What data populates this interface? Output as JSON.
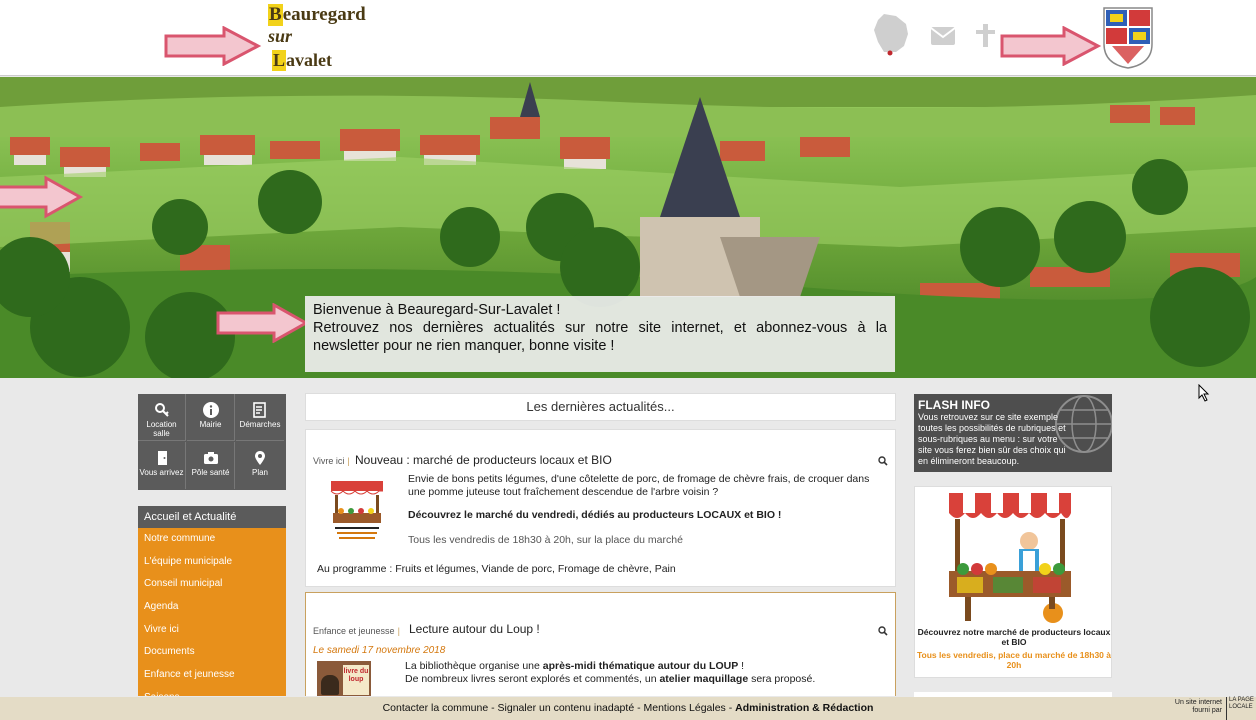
{
  "header": {
    "logo": {
      "line1_cap": "B",
      "line1_rest": "eauregard",
      "line2": "sur",
      "line3_cap": "L",
      "line3_rest": "avalet"
    },
    "icons": [
      "france-map-icon",
      "mail-icon",
      "cross-icon",
      "coat-of-arms-icon"
    ]
  },
  "hero": {
    "welcome_line1": "Bienvenue à Beauregard-Sur-Lavalet !",
    "welcome_line2": "Retrouvez nos dernières actualités sur notre site internet, et abonnez-vous à la newsletter pour ne rien manquer, bonne visite !"
  },
  "quick_links": [
    {
      "label": "Location salle",
      "icon": "key-icon"
    },
    {
      "label": "Mairie",
      "icon": "info-icon"
    },
    {
      "label": "Démarches",
      "icon": "form-icon"
    },
    {
      "label": "Vous arrivez",
      "icon": "door-icon"
    },
    {
      "label": "Pôle santé",
      "icon": "camera-icon"
    },
    {
      "label": "Plan",
      "icon": "map-pin-icon"
    }
  ],
  "menu": {
    "active": "Accueil et Actualité",
    "items": [
      "Notre commune",
      "L'équipe municipale",
      "Conseil municipal",
      "Agenda",
      "Vivre ici",
      "Documents",
      "Enfance et jeunesse",
      "Saisons"
    ]
  },
  "center": {
    "title": "Les dernières actualités...",
    "article1": {
      "category": "Vivre ici",
      "title": "Nouveau : marché de producteurs locaux et BIO",
      "text1": "Envie de bons petits légumes, d'une côtelette de porc, de fromage de chèvre frais, de croquer dans une pomme juteuse tout fraîchement descendue de l'arbre voisin ?",
      "text2": "Découvrez le marché du vendredi, dédiés au producteurs LOCAUX et BIO !",
      "text3": "Tous les vendredis de 18h30 à 20h, sur la place du marché",
      "program": "Au programme : Fruits et légumes, Viande de porc, Fromage de chèvre, Pain"
    },
    "article2": {
      "category": "Enfance et jeunesse",
      "title": "Lecture autour du Loup !",
      "date": "Le samedi 17 novembre 2018",
      "text1_a": "La bibliothèque organise une ",
      "text1_b": "après-midi thématique autour du LOUP",
      "text1_c": " !",
      "text2_a": "De nombreux livres seront explorés et commentés, un ",
      "text2_b": "atelier maquillage",
      "text2_c": " sera proposé.",
      "thumb_text": "livre du loup"
    }
  },
  "right": {
    "flash_title": "FLASH INFO",
    "flash_body": "Vous retrouvez sur ce site exemple toutes les possibilités de rubriques et sous-rubriques au menu : sur votre site vous ferez bien sûr des choix qui en élimineront beaucoup.",
    "ad_title": "Découvrez notre marché de producteurs locaux et BIO",
    "ad_sub": "Tous les vendredis, place du marché de 18h30 à 20h"
  },
  "footer": {
    "contact": "Contacter la commune",
    "report": "Signaler un contenu inadapté",
    "legal": "Mentions Légales",
    "admin": "Administration & Rédaction",
    "sep": " - ",
    "provider": "Un site internet fourni par",
    "provider_logo": "LA PAGE LOCALE"
  },
  "colors": {
    "accent": "#e8901b",
    "dark": "#5b5b5b",
    "arrow": "#d9556e"
  }
}
